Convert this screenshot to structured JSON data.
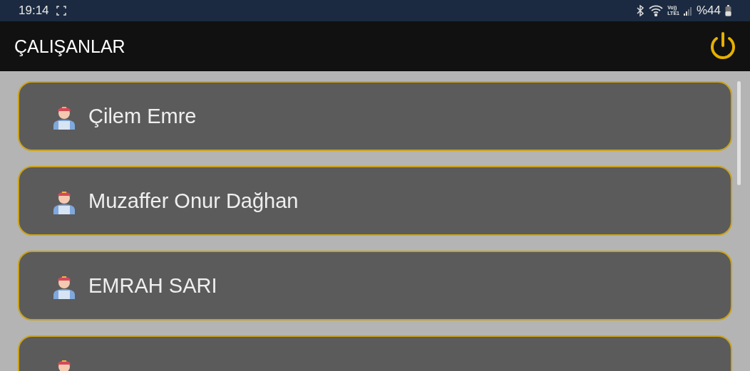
{
  "status_bar": {
    "time": "19:14",
    "network_top": "Vo))",
    "network_bottom": "LTE1",
    "battery": "%44"
  },
  "app_bar": {
    "title": "ÇALIŞANLAR"
  },
  "employees": [
    {
      "kind": "named",
      "name": "Çilem Emre"
    },
    {
      "kind": "named",
      "name": "Muzaffer Onur Dağhan"
    },
    {
      "kind": "named",
      "name": "EMRAH SARI"
    },
    {
      "kind": "cut_off"
    }
  ]
}
